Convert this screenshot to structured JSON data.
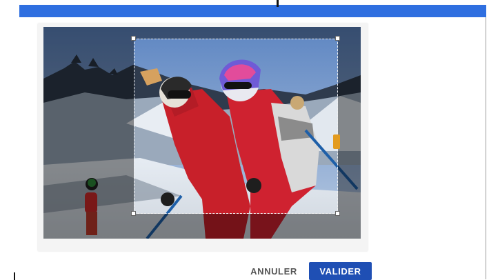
{
  "dialog": {
    "image": {
      "alt": "ski-instructor-photo"
    },
    "crop_tool": {
      "active": true
    }
  },
  "actions": {
    "cancel_label": "ANNULER",
    "validate_label": "VALIDER"
  },
  "colors": {
    "header_bar": "#2f6fe0",
    "primary_button": "#1f4fb4",
    "crop_side_handle": "#e39b1f",
    "jacket_red": "#c8202a"
  },
  "icons": [
    "crop-corner-handle-icon",
    "crop-side-handle-icon"
  ]
}
